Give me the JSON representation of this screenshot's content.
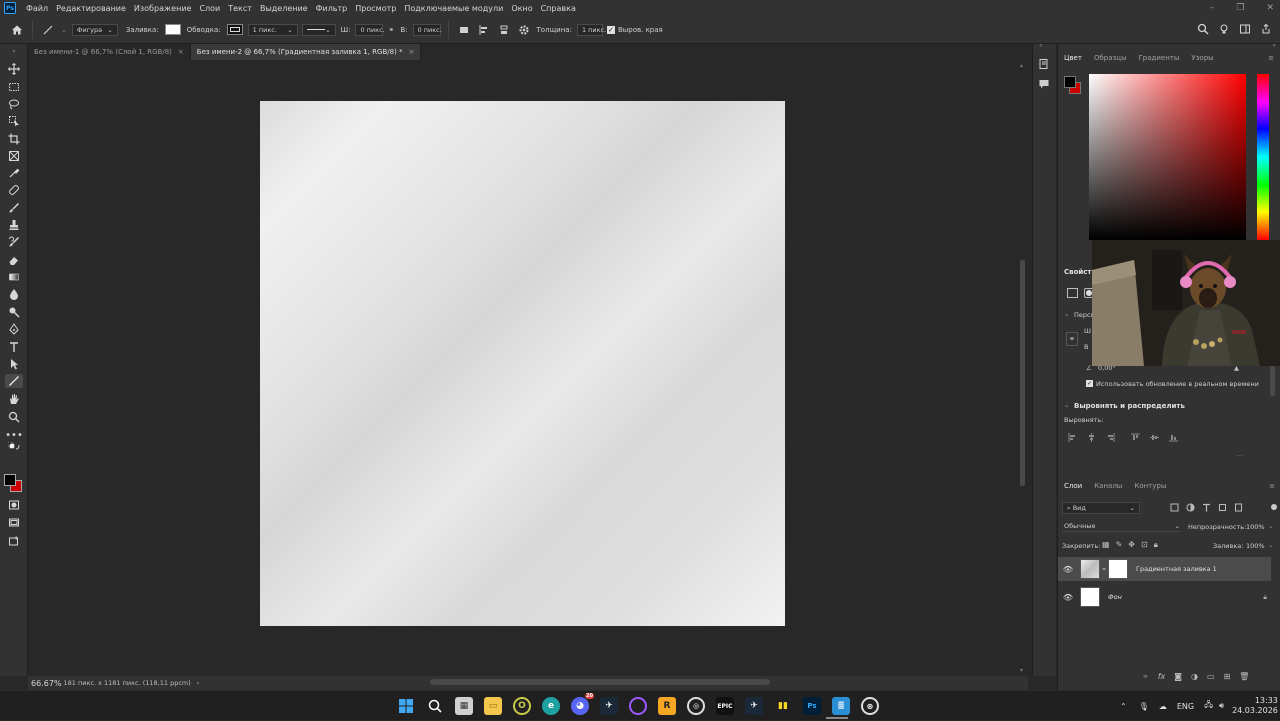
{
  "menubar": {
    "logo": "Ps",
    "items": [
      "Файл",
      "Редактирование",
      "Изображение",
      "Слои",
      "Текст",
      "Выделение",
      "Фильтр",
      "Просмотр",
      "Подключаемые модули",
      "Окно",
      "Справка"
    ]
  },
  "options": {
    "mode": "Фигура",
    "fill_label": "Заливка:",
    "stroke_label": "Обводка:",
    "stroke_width": "1 пикс.",
    "w_label": "Ш:",
    "w_value": "0 пикс.",
    "h_label": "В:",
    "h_value": "0 пикс.",
    "thickness_label": "Толщина:",
    "thickness_value": "1 пикс.",
    "align_edges_label": "Выров. края"
  },
  "tabs": [
    {
      "label": "Без имени-1 @ 66,7% (Слой 1, RGB/8)",
      "active": false
    },
    {
      "label": "Без имени-2 @ 66,7% (Градиентная заливка 1, RGB/8) *",
      "active": true
    }
  ],
  "status": {
    "zoom": "66.67%",
    "info": "181 пикс. x 1181 пикс. (118,11 ppcm)",
    "arrow": "›"
  },
  "color_panel": {
    "tabs": [
      "Цвет",
      "Образцы",
      "Градиенты",
      "Узоры"
    ],
    "foreground": "#000000",
    "background": "#cc0000"
  },
  "properties": {
    "title": "Свойства",
    "perspective_label": "Перспе",
    "w_short": "Ш",
    "h_short": "В",
    "angle_value": "0,00°",
    "live_update_label": "Использовать обновление в реальном времени",
    "align_title": "Выровнять и распределить",
    "align_label": "Выровнять:",
    "more": "..."
  },
  "layers": {
    "tabs": [
      "Слои",
      "Каналы",
      "Контуры"
    ],
    "kind_filter": "Вид",
    "blend_mode": "Обычные",
    "opacity_label": "Непрозрачность:",
    "opacity_value": "100%",
    "lock_label": "Закрепить:",
    "fill_label": "Заливка:",
    "fill_value": "100%",
    "items": [
      {
        "name": "Градиентная заливка 1",
        "selected": true
      },
      {
        "name": "Фон",
        "selected": false
      }
    ]
  },
  "taskbar": {
    "language": "ENG",
    "time": "13:33",
    "date": "24.03.2026",
    "discord_badge": "20"
  }
}
